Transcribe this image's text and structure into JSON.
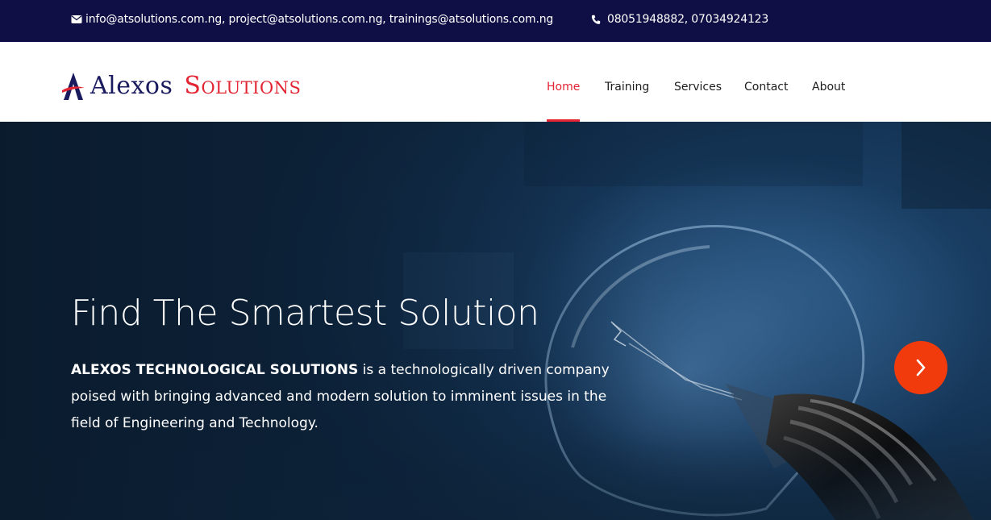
{
  "topbar": {
    "email_icon": "envelope-icon",
    "emails": "info@atsolutions.com.ng, project@atsolutions.com.ng, trainings@atsolutions.com.ng",
    "phone_icon": "phone-icon",
    "phones": "08051948882,  07034924123"
  },
  "logo": {
    "word1": "Alexos",
    "word2": "Solutions"
  },
  "nav": {
    "items": [
      {
        "label": "Home",
        "active": true
      },
      {
        "label": "Training",
        "active": false
      },
      {
        "label": "Services",
        "active": false
      },
      {
        "label": "Contact",
        "active": false
      },
      {
        "label": "About",
        "active": false
      }
    ]
  },
  "hero": {
    "title": "Find The Smartest Solution",
    "company_name": "ALEXOS TECHNOLOGICAL SOLUTIONS",
    "description": " is a technologically driven company poised with bringing advanced and modern solution to imminent issues in the field of Engineering and Technology.",
    "next_icon": "chevron-right-icon"
  },
  "colors": {
    "topbar_bg": "#0f0f45",
    "accent_red": "#e22433",
    "next_button": "#f23b0c",
    "logo_navy": "#1a1a5e"
  }
}
